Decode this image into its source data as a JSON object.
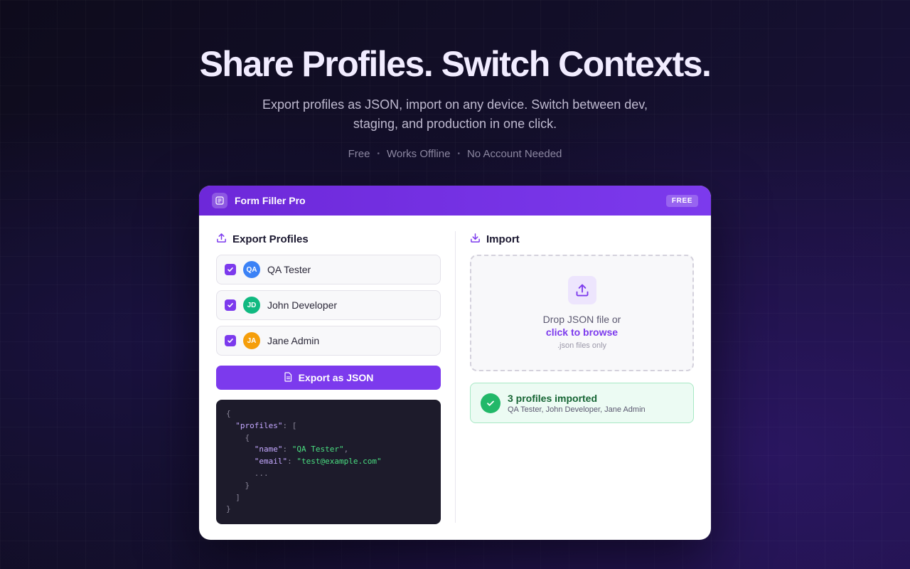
{
  "hero": {
    "title": "Share Profiles. Switch Contexts.",
    "subtitle": "Export profiles as JSON, import on any device. Switch between dev, staging, and production in one click.",
    "tags": [
      "Free",
      "Works Offline",
      "No Account Needed"
    ],
    "separator": "•"
  },
  "window": {
    "app_title": "Form Filler Pro",
    "badge": "FREE",
    "accent_color": "#7c3aed"
  },
  "export": {
    "title": "Export Profiles",
    "profiles": [
      {
        "initials": "QA",
        "name": "QA Tester",
        "color": "#3b82f6",
        "checked": true
      },
      {
        "initials": "JD",
        "name": "John Developer",
        "color": "#10b981",
        "checked": true
      },
      {
        "initials": "JA",
        "name": "Jane Admin",
        "color": "#f59e0b",
        "checked": true
      }
    ],
    "button_label": "Export as JSON",
    "code_preview": {
      "profiles_key": "\"profiles\"",
      "name_key": "\"name\"",
      "name_value": "\"QA Tester\"",
      "email_key": "\"email\"",
      "email_value": "\"test@example.com\"",
      "ellipsis": "..."
    }
  },
  "import": {
    "title": "Import",
    "drop_text": "Drop JSON file or",
    "browse_link": "click to browse",
    "hint": ".json files only",
    "success_title": "3 profiles imported",
    "success_detail": "QA Tester, John Developer, Jane Admin"
  }
}
